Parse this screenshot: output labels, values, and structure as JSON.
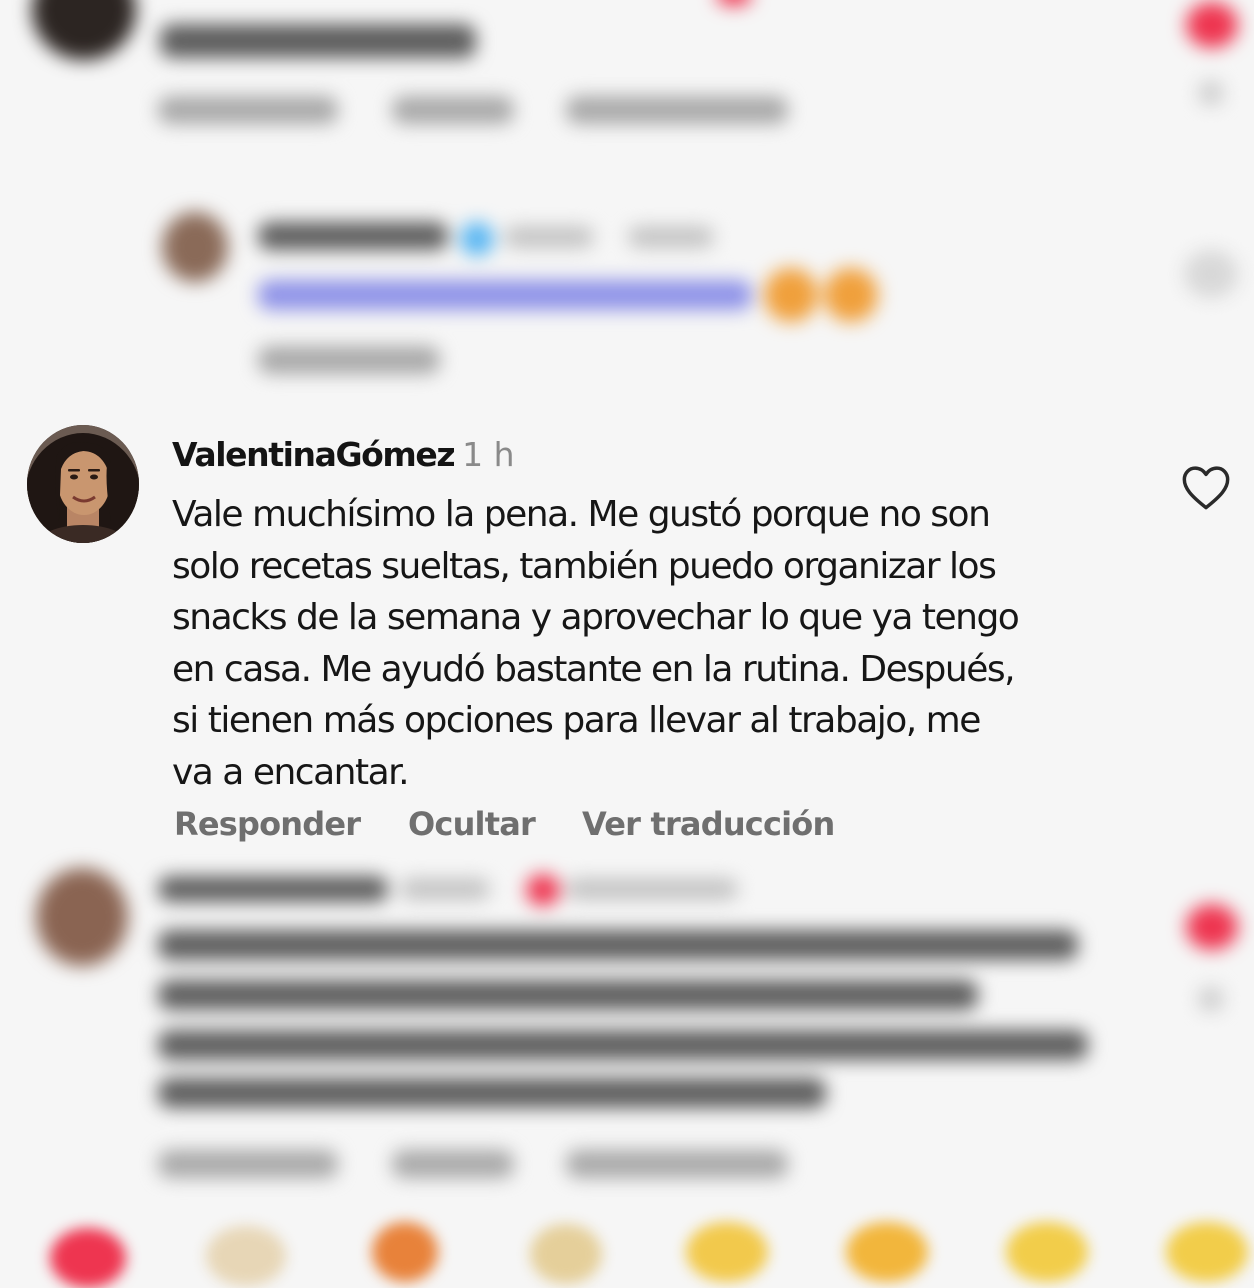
{
  "comment": {
    "username": "ValentinaGómez",
    "time": "1 h",
    "lines": [
      "Vale muchísimo la pena. Me gustó porque no son",
      "solo recetas sueltas, también puedo organizar los",
      "snacks de la semana y aprovechar lo que ya tengo",
      "en casa. Me ayudó bastante en la rutina. Después,",
      "si tienen más opciones para llevar al trabajo, me",
      "va a encantar."
    ],
    "actions": {
      "reply": "Responder",
      "hide": "Ocultar",
      "translate": "Ver traducción"
    }
  },
  "colors": {
    "background": "#f6f6f6",
    "text": "#161616",
    "muted": "#6f6f6f",
    "like_red": "#ee3550",
    "mention_blue": "#8f93e8"
  },
  "icons": {
    "like": "heart-outline-icon",
    "liked": "heart-filled-icon"
  }
}
